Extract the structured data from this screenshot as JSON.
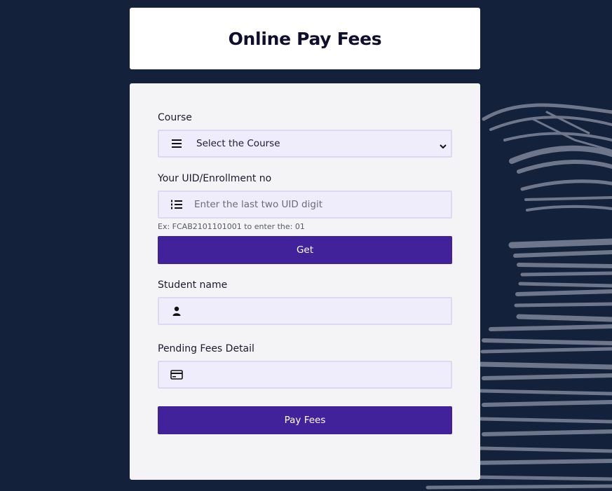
{
  "page": {
    "title": "Online Pay Fees"
  },
  "form": {
    "course": {
      "label": "Course",
      "selected": "Select the Course"
    },
    "uid": {
      "label": "Your UID/Enrollment no",
      "placeholder": "Enter the last two UID digit",
      "hint": "Ex: FCAB2101101001 to enter the: 01"
    },
    "get_button": "Get",
    "student_name": {
      "label": "Student name",
      "value": ""
    },
    "pending_fees": {
      "label": "Pending Fees Detail",
      "value": ""
    },
    "pay_button": "Pay Fees"
  },
  "colors": {
    "background": "#13213a",
    "button": "#41229a",
    "field_bg": "#efedfb",
    "field_border": "#dcdaf3"
  },
  "icons": {
    "course": "bars-icon",
    "uid": "list-ol-icon",
    "student": "user-icon",
    "fees": "credit-card-icon",
    "select": "chevron-down-icon"
  }
}
